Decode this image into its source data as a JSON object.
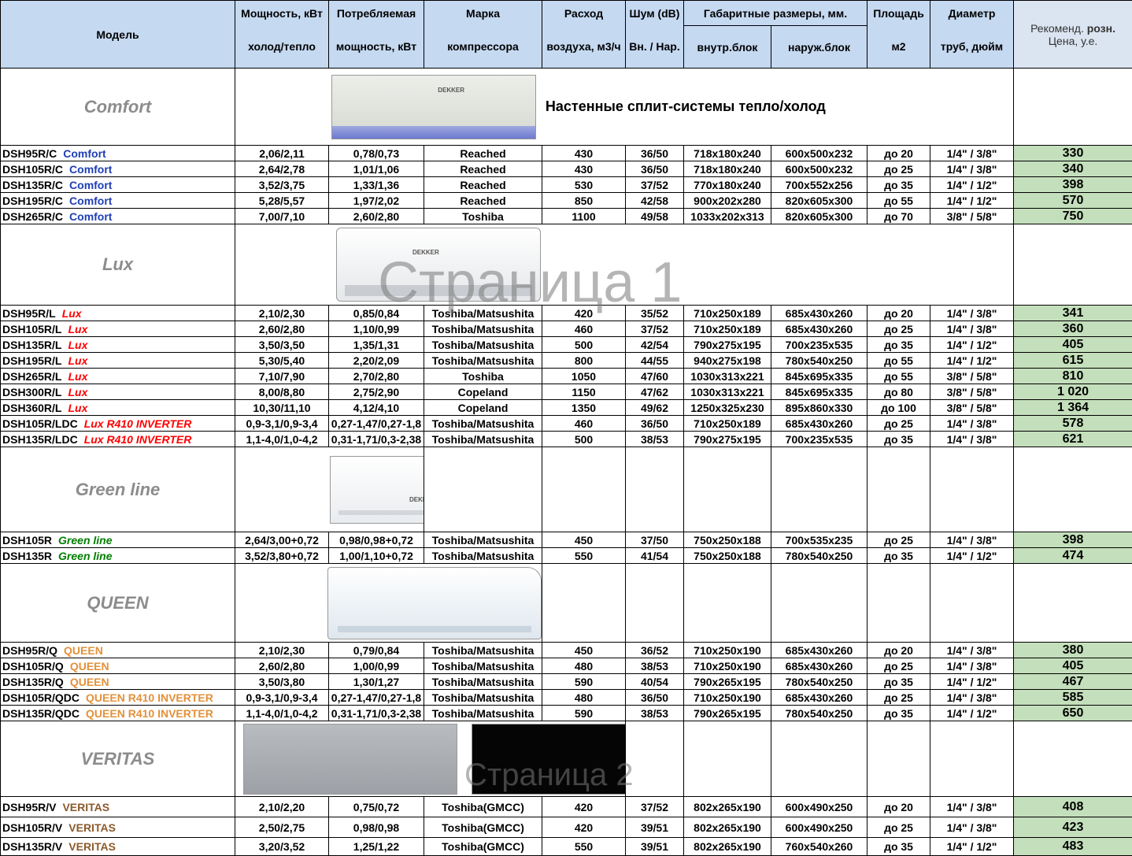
{
  "headers": {
    "model": "Модель",
    "power_1": "Мощность, кВт",
    "power_2": "холод/тепло",
    "consumption_1": "Потребляемая",
    "consumption_2": "мощность, кВт",
    "compressor_1": "Марка",
    "compressor_2": "компрессора",
    "airflow_1": "Расход",
    "airflow_2": "воздуха, м3/ч",
    "noise_1": "Шум (dB)",
    "noise_2": "Вн. / Нар.",
    "dims": "Габаритные размеры, мм.",
    "dims_in": "внутр.блок",
    "dims_out": "наруж.блок",
    "area_1": "Площадь",
    "area_2": "м2",
    "pipe_1": "Диаметр",
    "pipe_2": "труб, дюйм",
    "price_1a": "Рекоменд. ",
    "price_1b": "розн.",
    "price_2": "Цена, у.е."
  },
  "sections": {
    "comfort": {
      "name": "Comfort",
      "caption": "Настенные сплит-системы тепло/холод",
      "image_brand": "DEKKER",
      "rows": [
        {
          "model": "DSH95R/C",
          "series": "Comfort",
          "power": "2,06/2,11",
          "consumption": "0,78/0,73",
          "compressor": "Reached",
          "airflow": "430",
          "noise": "36/50",
          "dim_in": "718x180x240",
          "dim_out": "600x500x232",
          "area": "до 20",
          "pipe": "1/4\" / 3/8\"",
          "price": "330"
        },
        {
          "model": "DSH105R/C",
          "series": "Comfort",
          "power": "2,64/2,78",
          "consumption": "1,01/1,06",
          "compressor": "Reached",
          "airflow": "430",
          "noise": "36/50",
          "dim_in": "718x180x240",
          "dim_out": "600x500x232",
          "area": "до 25",
          "pipe": "1/4\" / 3/8\"",
          "price": "340"
        },
        {
          "model": "DSH135R/C",
          "series": "Comfort",
          "power": "3,52/3,75",
          "consumption": "1,33/1,36",
          "compressor": "Reached",
          "airflow": "530",
          "noise": "37/52",
          "dim_in": "770x180x240",
          "dim_out": "700x552x256",
          "area": "до 35",
          "pipe": "1/4\" / 1/2\"",
          "price": "398"
        },
        {
          "model": "DSH195R/C",
          "series": "Comfort",
          "power": "5,28/5,57",
          "consumption": "1,97/2,02",
          "compressor": "Reached",
          "airflow": "850",
          "noise": "42/58",
          "dim_in": "900x202x280",
          "dim_out": "820x605x300",
          "area": "до 55",
          "pipe": "1/4\" / 1/2\"",
          "price": "570"
        },
        {
          "model": "DSH265R/C",
          "series": "Comfort",
          "power": "7,00/7,10",
          "consumption": "2,60/2,80",
          "compressor": "Toshiba",
          "airflow": "1100",
          "noise": "49/58",
          "dim_in": "1033x202x313",
          "dim_out": "820x605x300",
          "area": "до 70",
          "pipe": "3/8\" / 5/8\"",
          "price": "750"
        }
      ]
    },
    "lux": {
      "name": "Lux",
      "image_brand": "DEKKER",
      "rows": [
        {
          "model": "DSH95R/L",
          "series": "Lux",
          "power": "2,10/2,30",
          "consumption": "0,85/0,84",
          "compressor": "Toshiba/Matsushita",
          "airflow": "420",
          "noise": "35/52",
          "dim_in": "710x250x189",
          "dim_out": "685x430x260",
          "area": "до 20",
          "pipe": "1/4\" / 3/8\"",
          "price": "341"
        },
        {
          "model": "DSH105R/L",
          "series": "Lux",
          "power": "2,60/2,80",
          "consumption": "1,10/0,99",
          "compressor": "Toshiba/Matsushita",
          "airflow": "460",
          "noise": "37/52",
          "dim_in": "710x250x189",
          "dim_out": "685x430x260",
          "area": "до 25",
          "pipe": "1/4\" / 3/8\"",
          "price": "360"
        },
        {
          "model": "DSH135R/L",
          "series": "Lux",
          "power": "3,50/3,50",
          "consumption": "1,35/1,31",
          "compressor": "Toshiba/Matsushita",
          "airflow": "500",
          "noise": "42/54",
          "dim_in": "790x275x195",
          "dim_out": "700x235x535",
          "area": "до 35",
          "pipe": "1/4\" / 1/2\"",
          "price": "405"
        },
        {
          "model": "DSH195R/L",
          "series": "Lux",
          "power": "5,30/5,40",
          "consumption": "2,20/2,09",
          "compressor": "Toshiba/Matsushita",
          "airflow": "800",
          "noise": "44/55",
          "dim_in": "940x275x198",
          "dim_out": "780x540x250",
          "area": "до 55",
          "pipe": "1/4\" / 1/2\"",
          "price": "615"
        },
        {
          "model": "DSH265R/L",
          "series": "Lux",
          "power": "7,10/7,90",
          "consumption": "2,70/2,80",
          "compressor": "Toshiba",
          "airflow": "1050",
          "noise": "47/60",
          "dim_in": "1030x313x221",
          "dim_out": "845x695x335",
          "area": "до 55",
          "pipe": "3/8\" / 5/8\"",
          "price": "810"
        },
        {
          "model": "DSH300R/L",
          "series": "Lux",
          "power": "8,00/8,80",
          "consumption": "2,75/2,90",
          "compressor": "Copeland",
          "airflow": "1150",
          "noise": "47/62",
          "dim_in": "1030x313x221",
          "dim_out": "845x695x335",
          "area": "до 80",
          "pipe": "3/8\" / 5/8\"",
          "price": "1 020"
        },
        {
          "model": "DSH360R/L",
          "series": "Lux",
          "power": "10,30/11,10",
          "consumption": "4,12/4,10",
          "compressor": "Copeland",
          "airflow": "1350",
          "noise": "49/62",
          "dim_in": "1250x325x230",
          "dim_out": "895x860x330",
          "area": "до 100",
          "pipe": "3/8\" / 5/8\"",
          "price": "1 364"
        },
        {
          "model": "DSH105R/LDC",
          "series": "Lux R410 INVERTER",
          "power": "0,9-3,1/0,9-3,4",
          "consumption": "0,27-1,47/0,27-1,8",
          "compressor": "Toshiba/Matsushita",
          "airflow": "460",
          "noise": "36/50",
          "dim_in": "710x250x189",
          "dim_out": "685x430x260",
          "area": "до 25",
          "pipe": "1/4\" / 3/8\"",
          "price": "578"
        },
        {
          "model": "DSH135R/LDC",
          "series": "Lux  R410 INVERTER",
          "power": "1,1-4,0/1,0-4,2",
          "consumption": "0,31-1,71/0,3-2,38",
          "compressor": "Toshiba/Matsushita",
          "airflow": "500",
          "noise": "38/53",
          "dim_in": "790x275x195",
          "dim_out": "700x235x535",
          "area": "до 35",
          "pipe": "1/4\" / 3/8\"",
          "price": "621"
        }
      ]
    },
    "green": {
      "name": "Green line",
      "image_brand": "DEKKER",
      "rows": [
        {
          "model": "DSH105R",
          "series": "Green line",
          "power": "2,64/3,00+0,72",
          "consumption": "0,98/0,98+0,72",
          "compressor": "Toshiba/Matsushita",
          "airflow": "450",
          "noise": "37/50",
          "dim_in": "750x250x188",
          "dim_out": "700x535x235",
          "area": "до 25",
          "pipe": "1/4\" / 3/8\"",
          "price": "398"
        },
        {
          "model": "DSH135R",
          "series": "Green line",
          "power": "3,52/3,80+0,72",
          "consumption": "1,00/1,10+0,72",
          "compressor": "Toshiba/Matsushita",
          "airflow": "550",
          "noise": "41/54",
          "dim_in": "750x250x188",
          "dim_out": "780x540x250",
          "area": "до 35",
          "pipe": "1/4\" / 1/2\"",
          "price": "474"
        }
      ]
    },
    "queen": {
      "name": "QUEEN",
      "rows": [
        {
          "model": "DSH95R/Q",
          "series": "QUEEN",
          "power": "2,10/2,30",
          "consumption": "0,79/0,84",
          "compressor": "Toshiba/Matsushita",
          "airflow": "450",
          "noise": "36/52",
          "dim_in": "710x250x190",
          "dim_out": "685x430x260",
          "area": "до 20",
          "pipe": "1/4\" / 3/8\"",
          "price": "380"
        },
        {
          "model": "DSH105R/Q",
          "series": "QUEEN",
          "power": "2,60/2,80",
          "consumption": "1,00/0,99",
          "compressor": "Toshiba/Matsushita",
          "airflow": "480",
          "noise": "38/53",
          "dim_in": "710x250x190",
          "dim_out": "685x430x260",
          "area": "до 25",
          "pipe": "1/4\" / 3/8\"",
          "price": "405"
        },
        {
          "model": "DSH135R/Q",
          "series": "QUEEN",
          "power": "3,50/3,80",
          "consumption": "1,30/1,27",
          "compressor": "Toshiba/Matsushita",
          "airflow": "590",
          "noise": "40/54",
          "dim_in": "790x265x195",
          "dim_out": "780x540x250",
          "area": "до 35",
          "pipe": "1/4\" / 1/2\"",
          "price": "467"
        },
        {
          "model": "DSH105R/QDC",
          "series": "QUEEN R410 INVERTER",
          "power": "0,9-3,1/0,9-3,4",
          "consumption": "0,27-1,47/0,27-1,8",
          "compressor": "Toshiba/Matsushita",
          "airflow": "480",
          "noise": "36/50",
          "dim_in": "710x250x190",
          "dim_out": "685x430x260",
          "area": "до 25",
          "pipe": "1/4\" / 3/8\"",
          "price": "585"
        },
        {
          "model": "DSH135R/QDC",
          "series": "QUEEN R410 INVERTER",
          "power": "1,1-4,0/1,0-4,2",
          "consumption": "0,31-1,71/0,3-2,38",
          "compressor": "Toshiba/Matsushita",
          "airflow": "590",
          "noise": "38/53",
          "dim_in": "790x265x195",
          "dim_out": "780x540x250",
          "area": "до 35",
          "pipe": "1/4\" / 1/2\"",
          "price": "650"
        }
      ]
    },
    "veritas": {
      "name": "VERITAS",
      "rows": [
        {
          "model": "DSH95R/V",
          "series": "VERITAS",
          "power": "2,10/2,20",
          "consumption": "0,75/0,72",
          "compressor": "Toshiba(GMCC)",
          "airflow": "420",
          "noise": "37/52",
          "dim_in": "802x265x190",
          "dim_out": "600x490x250",
          "area": "до 20",
          "pipe": "1/4\" / 3/8\"",
          "price": "408"
        },
        {
          "model": "DSH105R/V",
          "series": "VERITAS",
          "power": "2,50/2,75",
          "consumption": "0,98/0,98",
          "compressor": "Toshiba(GMCC)",
          "airflow": "420",
          "noise": "39/51",
          "dim_in": "802x265x190",
          "dim_out": "600x490x250",
          "area": "до 25",
          "pipe": "1/4\" / 3/8\"",
          "price": "423"
        },
        {
          "model": "DSH135R/V",
          "series": "VERITAS",
          "power": "3,20/3,52",
          "consumption": "1,25/1,22",
          "compressor": "Toshiba(GMCC)",
          "airflow": "550",
          "noise": "39/51",
          "dim_in": "802x265x190",
          "dim_out": "760x540x260",
          "area": "до 35",
          "pipe": "1/4\" / 1/2\"",
          "price": "483"
        }
      ]
    }
  },
  "watermarks": [
    "Страница 1",
    "Страница 2"
  ],
  "colors": {
    "header_bg": "#c5d9f1",
    "price_bg": "#c4dfbb",
    "section_name": "#8c8c8c",
    "comfort_series": "#1f3fb4",
    "lux_series": "#ff0000",
    "green_series": "#008000",
    "queen_series": "#e2913a",
    "veritas_series": "#8b5a2b"
  }
}
